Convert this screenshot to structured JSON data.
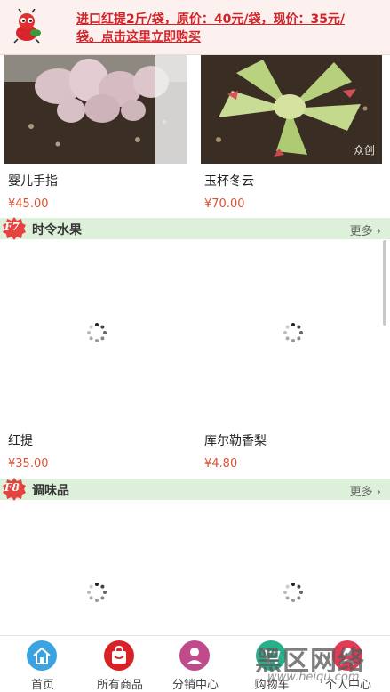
{
  "banner": {
    "text": "进口红提2斤/袋，原价：40元/袋，现价：35元/袋。点击这里立即购买",
    "mascot_icon": "ant-mascot-icon"
  },
  "row1": [
    {
      "name": "婴儿手指",
      "price": "¥45.00"
    },
    {
      "name": "玉杯冬云",
      "price": "¥70.00",
      "photo_watermark": "众创"
    }
  ],
  "sections": [
    {
      "badge": "F7",
      "title": "时令水果",
      "more": "更多"
    },
    {
      "badge": "F8",
      "title": "调味品",
      "more": "更多"
    }
  ],
  "row2": [
    {
      "name": "红提",
      "price": "¥35.00"
    },
    {
      "name": "库尔勒香梨",
      "price": "¥4.80"
    }
  ],
  "bottom_nav": {
    "items": [
      {
        "label": "首页",
        "icon": "home-icon",
        "color": "#3aa3e0"
      },
      {
        "label": "所有商品",
        "icon": "shopping-bag-icon",
        "color": "#d92226"
      },
      {
        "label": "分销中心",
        "icon": "distribution-icon",
        "color": "#c14a8c"
      },
      {
        "label": "购物车",
        "icon": "cart-icon",
        "color": "#27b08a"
      },
      {
        "label": "个人中心",
        "icon": "user-icon",
        "color": "#e23b56"
      }
    ]
  },
  "site_watermark": {
    "title": "黑区网络",
    "url": "www.heiqu.com"
  },
  "colors": {
    "accent_red": "#d0242a",
    "price": "#e0502f",
    "section_bg": "#ddf0da"
  }
}
